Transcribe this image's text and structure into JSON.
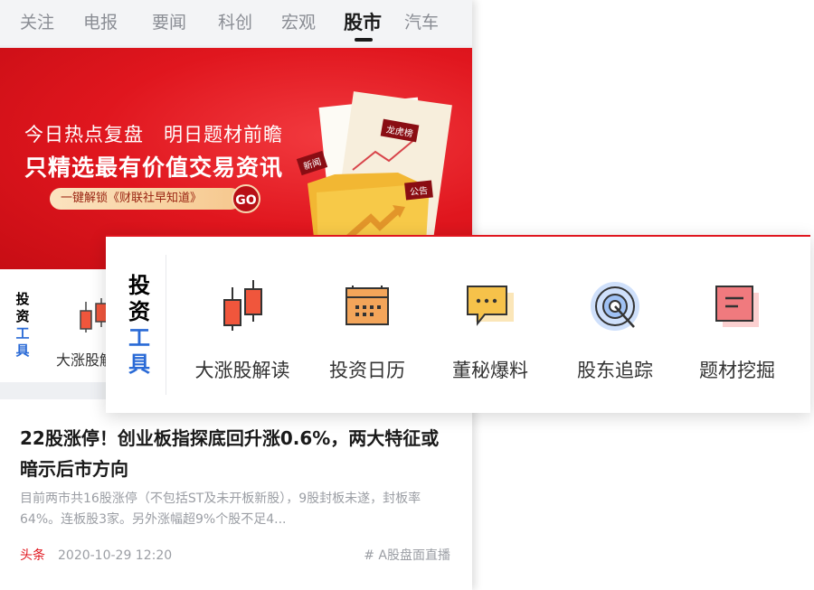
{
  "tabs": [
    "关注",
    "电报",
    "要闻",
    "科创",
    "宏观",
    "股市",
    "汽车"
  ],
  "active_tab": "股市",
  "banner": {
    "line1": "今日热点复盘　明日题材前瞻",
    "line2": "只精选最有价值交易资讯",
    "cta": "一键解锁《财联社早知道》",
    "go": "GO",
    "folder_tags": [
      "龙虎榜",
      "新闻",
      "公告"
    ]
  },
  "tools_panel": {
    "label_top": "投资",
    "label_bottom": "工具",
    "items": [
      {
        "label": "大涨股解读",
        "icon": "candlestick-icon"
      },
      {
        "label": "投资日历",
        "icon": "calendar-icon"
      },
      {
        "label": "董秘爆料",
        "icon": "chat-bubble-icon"
      },
      {
        "label": "股东追踪",
        "icon": "target-icon"
      },
      {
        "label": "题材挖掘",
        "icon": "document-icon"
      }
    ]
  },
  "under_row": {
    "label": "大涨股解"
  },
  "article": {
    "title": "22股涨停！创业板指探底回升涨0.6%，两大特征或暗示后市方向",
    "body": "目前两市共16股涨停（不包括ST及未开板新股），9股封板未遂，封板率64%。连板股3家。另外涨幅超9%个股不足4...",
    "tag": "头条",
    "time": "2020-10-29 12:20",
    "topic": "# A股盘面直播"
  },
  "colors": {
    "brand_red": "#e0161e",
    "accent_blue": "#2a6ad6"
  }
}
